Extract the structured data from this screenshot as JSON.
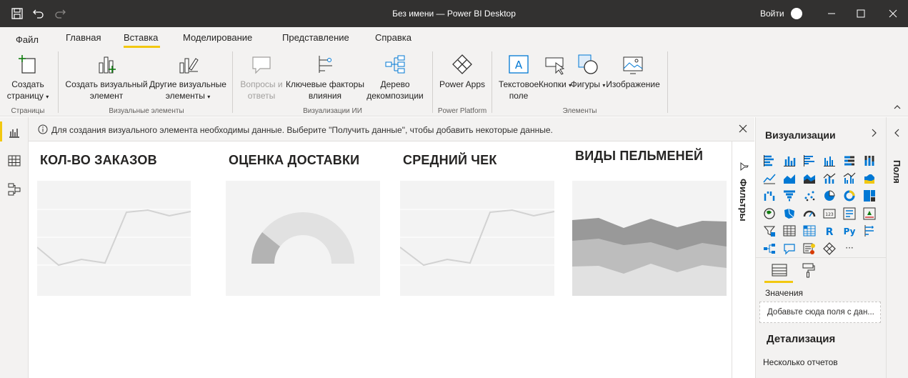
{
  "window": {
    "title": "Без имени — Power BI Desktop",
    "sign_in": "Войти"
  },
  "tabs": [
    {
      "label": "Файл"
    },
    {
      "label": "Главная"
    },
    {
      "label": "Вставка",
      "active": true
    },
    {
      "label": "Моделирование"
    },
    {
      "label": "Представление"
    },
    {
      "label": "Справка"
    }
  ],
  "ribbon": {
    "buttons": {
      "new_page": "Создать страницу",
      "new_visual": "Создать визуальный элемент",
      "more_visuals": "Другие визуальные элементы",
      "qa": "Вопросы и ответы",
      "key_influencers": "Ключевые факторы влияния",
      "decomp_tree": "Дерево декомпозиции",
      "power_apps": "Power Apps",
      "text_box": "Текстовое поле",
      "buttons": "Кнопки",
      "shapes": "Фигуры",
      "image": "Изображение"
    },
    "groups": {
      "pages": "Страницы",
      "visuals": "Визуальные элементы",
      "ai_visuals": "Визуализации ИИ",
      "power_platform": "Power Platform",
      "elements": "Элементы"
    },
    "accent_color": "#f2c811"
  },
  "canvas": {
    "info_message": "Для создания визуального элемента необходимы данные. Выберите \"Получить данные\", чтобы добавить некоторые данные.",
    "visual_titles": [
      "КОЛ-ВО ЗАКАЗОВ",
      "ОЦЕНКА ДОСТАВКИ",
      "СРЕДНИЙ ЧЕК",
      "ВИДЫ ПЕЛЬМЕНЕЙ"
    ],
    "placeholder_types": [
      "line",
      "gauge",
      "line",
      "area"
    ]
  },
  "filters_pane": {
    "label": "Фильтры"
  },
  "viz_pane": {
    "title": "Визуализации",
    "values_label": "Значения",
    "drop_placeholder": "Добавьте сюда поля с дан...",
    "drillthrough": "Детализация",
    "multiple_reports": "Несколько отчетов",
    "icons": [
      "stacked-bar-icon",
      "stacked-column-icon",
      "clustered-bar-icon",
      "clustered-column-icon",
      "100-bar-icon",
      "100-column-icon",
      "line-icon",
      "area-icon",
      "stacked-area-icon",
      "line-column-icon",
      "line-clustered-column-icon",
      "ribbon-icon",
      "waterfall-icon",
      "funnel-icon",
      "scatter-icon",
      "pie-icon",
      "donut-icon",
      "treemap-icon",
      "map-icon",
      "filled-map-icon",
      "gauge-icon",
      "card-icon",
      "multi-row-card-icon",
      "kpi-icon",
      "slicer-icon",
      "table-icon",
      "matrix-icon",
      "r-script-icon",
      "python-icon",
      "key-influencers-icon",
      "decomposition-tree-icon",
      "qa-icon",
      "smart-narrative-icon",
      "power-apps-icon",
      "more-icon"
    ],
    "r_label": "R",
    "py_label": "Py",
    "card_text": "123",
    "more_text": "···"
  },
  "fields_pane": {
    "label": "Поля"
  }
}
